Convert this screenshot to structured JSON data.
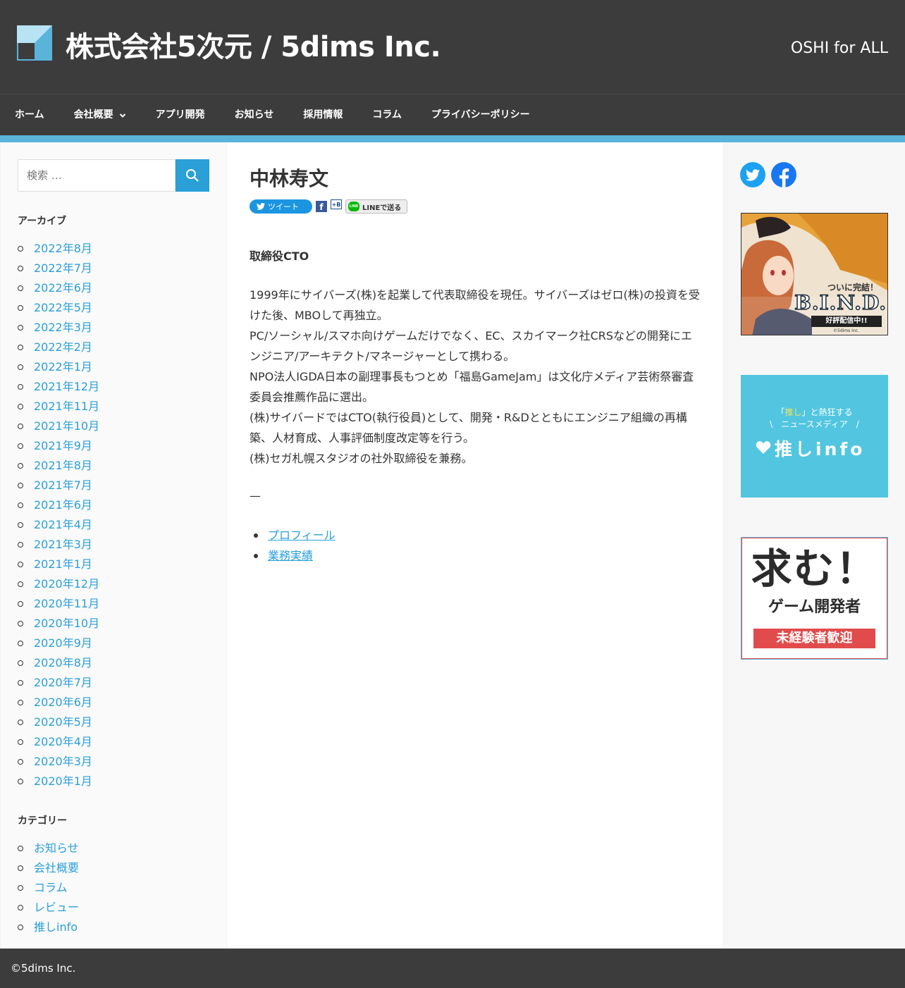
{
  "header": {
    "site_title": "株式会社5次元 / 5dims Inc.",
    "tagline": "OSHI for ALL"
  },
  "nav": {
    "items": [
      {
        "label": "ホーム"
      },
      {
        "label": "会社概要",
        "has_dropdown": true
      },
      {
        "label": "アプリ開発"
      },
      {
        "label": "お知らせ"
      },
      {
        "label": "採用情報"
      },
      {
        "label": "コラム"
      },
      {
        "label": "プライバシーポリシー"
      }
    ]
  },
  "search": {
    "placeholder": "検索 …"
  },
  "archives": {
    "title": "アーカイブ",
    "items": [
      "2022年8月",
      "2022年7月",
      "2022年6月",
      "2022年5月",
      "2022年3月",
      "2022年2月",
      "2022年1月",
      "2021年12月",
      "2021年11月",
      "2021年10月",
      "2021年9月",
      "2021年8月",
      "2021年7月",
      "2021年6月",
      "2021年4月",
      "2021年3月",
      "2021年1月",
      "2020年12月",
      "2020年11月",
      "2020年10月",
      "2020年9月",
      "2020年8月",
      "2020年7月",
      "2020年6月",
      "2020年5月",
      "2020年4月",
      "2020年3月",
      "2020年1月"
    ]
  },
  "categories": {
    "title": "カテゴリー",
    "items": [
      "お知らせ",
      "会社概要",
      "コラム",
      "レビュー",
      "推しinfo"
    ]
  },
  "post": {
    "title": "中林寿文",
    "share": {
      "tweet": "ツイート",
      "facebook": "f",
      "hatena": "+B",
      "line_icon": "LINE",
      "line": "LINEで送る"
    },
    "role": "取締役CTO",
    "paragraphs": [
      "1999年にサイバーズ(株)を起業して代表取締役を現任。サイバーズはゼロ(株)の投資を受けた後、MBOして再独立。",
      "PC/ソーシャル/スマホ向けゲームだけでなく、EC、スカイマーク社CRSなどの開発にエンジニア/アーキテクト/マネージャーとして携わる。",
      "NPO法人IGDA日本の副理事長もつとめ「福島GameJam」は文化庁メディア芸術祭審査委員会推薦作品に選出。",
      "(株)サイバードではCTO(執行役員)として、開発・R&Dとともにエンジニア組織の再構築、人材育成、人事評価制度改定等を行う。",
      "(株)セガ札幌スタジオの社外取締役を兼務。"
    ],
    "separator": "—",
    "links": [
      "プロフィール",
      "業務実績"
    ]
  },
  "sidebar_right": {
    "social": [
      "twitter-icon",
      "facebook-icon"
    ],
    "banners": {
      "bind": {
        "headline": "ついに完結！",
        "logo": "B.I.N.D.",
        "ribbon": "好評配信中!!",
        "credit": "©5dims Inc."
      },
      "oshi": {
        "line1_pre": "「",
        "line1_em": "推し",
        "line1_post": "」と熱狂する",
        "line2": "ニュースメディア",
        "logo": "推しinfo"
      },
      "recruit": {
        "headline": "求む！",
        "subhead": "ゲーム開発者",
        "badge": "未経験者歓迎"
      }
    }
  },
  "footer": {
    "copyright": "©5dims Inc."
  },
  "colors": {
    "header_bg": "#3c3c3c",
    "accent": "#5ab4d9",
    "link": "#2a9fd8",
    "twitter": "#1da1f2",
    "facebook": "#1877f2",
    "oshi_banner": "#52c6e0",
    "recruit_red": "#e14b4b"
  }
}
